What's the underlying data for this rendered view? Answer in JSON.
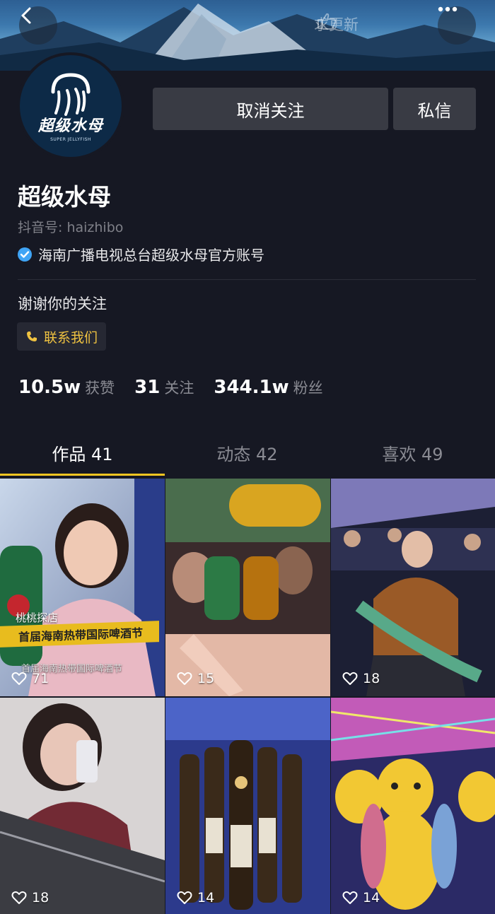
{
  "header": {
    "update_label": "求更新",
    "icons": [
      "back-icon",
      "hand-icon",
      "more-icon"
    ]
  },
  "avatar": {
    "brand_text": "超级水母",
    "brand_sub": "SUPER JELLYFISH"
  },
  "actions": {
    "unfollow_label": "取消关注",
    "message_label": "私信"
  },
  "profile": {
    "name": "超级水母",
    "douyin_id": "抖音号: haizhibo",
    "verified_text": "海南广播电视总台超级水母官方账号",
    "bio": "谢谢你的关注",
    "contact_label": "联系我们"
  },
  "stats": [
    {
      "value": "10.5w",
      "label": "获赞"
    },
    {
      "value": "31",
      "label": "关注"
    },
    {
      "value": "344.1w",
      "label": "粉丝"
    }
  ],
  "tabs": [
    {
      "label": "作品 41",
      "active": true
    },
    {
      "label": "动态 42",
      "active": false
    },
    {
      "label": "喜欢 49",
      "active": false
    }
  ],
  "videos": [
    {
      "likes": "71",
      "shop_tag": "桃桃探店",
      "caption": "首届海南热带国际啤酒节",
      "subcaption": "首届海南热带国际啤酒节"
    },
    {
      "likes": "15"
    },
    {
      "likes": "18"
    },
    {
      "likes": "18"
    },
    {
      "likes": "14"
    },
    {
      "likes": "14"
    }
  ],
  "colors": {
    "background": "#161823",
    "accent": "#f5c521",
    "button": "#393b44",
    "verified": "#3fa4f5"
  }
}
